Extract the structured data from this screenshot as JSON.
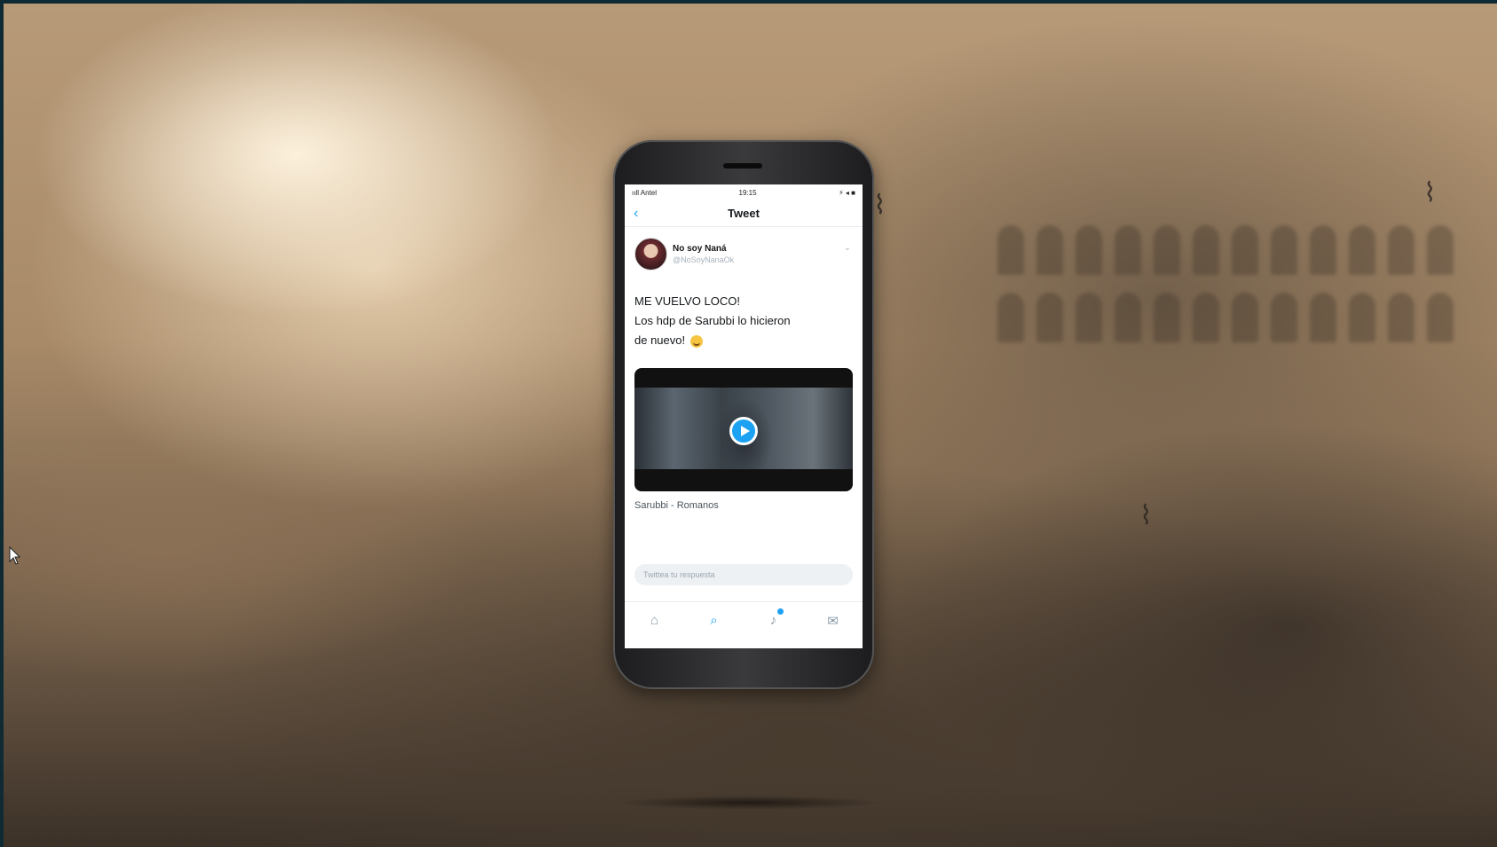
{
  "phone": {
    "status": {
      "carrier": "ııll Antel",
      "time": "19:15",
      "indicators": "⚡ ◂ ■"
    },
    "nav": {
      "title": "Tweet",
      "back_icon": "chevron-left-icon"
    },
    "tweet": {
      "author_name": "No soy Naná",
      "author_handle": "@NoSoyNanaOk",
      "text_line1": "ME VUELVO LOCO!",
      "text_line2": "Los hdp de Sarubbi lo hicieron",
      "text_line3": "de nuevo!",
      "emoji_icon": "grinning-face-icon",
      "video_caption": "Sarubbi - Romanos"
    },
    "reply": {
      "placeholder": "Twittea tu respuesta"
    },
    "tabs": [
      {
        "name": "home-icon",
        "glyph": "⌂"
      },
      {
        "name": "search-icon",
        "glyph": "⌕"
      },
      {
        "name": "bell-icon",
        "glyph": "♪"
      },
      {
        "name": "mail-icon",
        "glyph": "✉"
      }
    ]
  },
  "colors": {
    "accent": "#1da1f2",
    "text": "#14171a",
    "muted": "#8899a6"
  }
}
